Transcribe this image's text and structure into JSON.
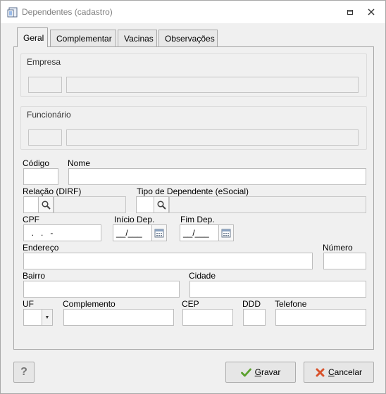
{
  "window": {
    "title": "Dependentes (cadastro)"
  },
  "tabs": [
    {
      "label": "Geral"
    },
    {
      "label": "Complementar"
    },
    {
      "label": "Vacinas"
    },
    {
      "label": "Observações"
    }
  ],
  "groups": {
    "empresa": "Empresa",
    "funcionario": "Funcionário"
  },
  "labels": {
    "codigo": "Código",
    "nome": "Nome",
    "relacao": "Relação (DIRF)",
    "tipo": "Tipo de Dependente (eSocial)",
    "cpf": "CPF",
    "inicio": "Início Dep.",
    "fim": "Fim Dep.",
    "endereco": "Endereço",
    "numero": "Número",
    "bairro": "Bairro",
    "cidade": "Cidade",
    "uf": "UF",
    "complemento": "Complemento",
    "cep": "CEP",
    "ddd": "DDD",
    "telefone": "Telefone"
  },
  "values": {
    "cpf": "  .   .   -",
    "inicio": "__/___",
    "fim": "__/___"
  },
  "buttons": {
    "help": "?",
    "save_first": "G",
    "save_rest": "ravar",
    "cancel_first": "C",
    "cancel_rest": "ancelar"
  },
  "colors": {
    "save_check": "#5aa02c",
    "cancel_x": "#d9532c"
  }
}
